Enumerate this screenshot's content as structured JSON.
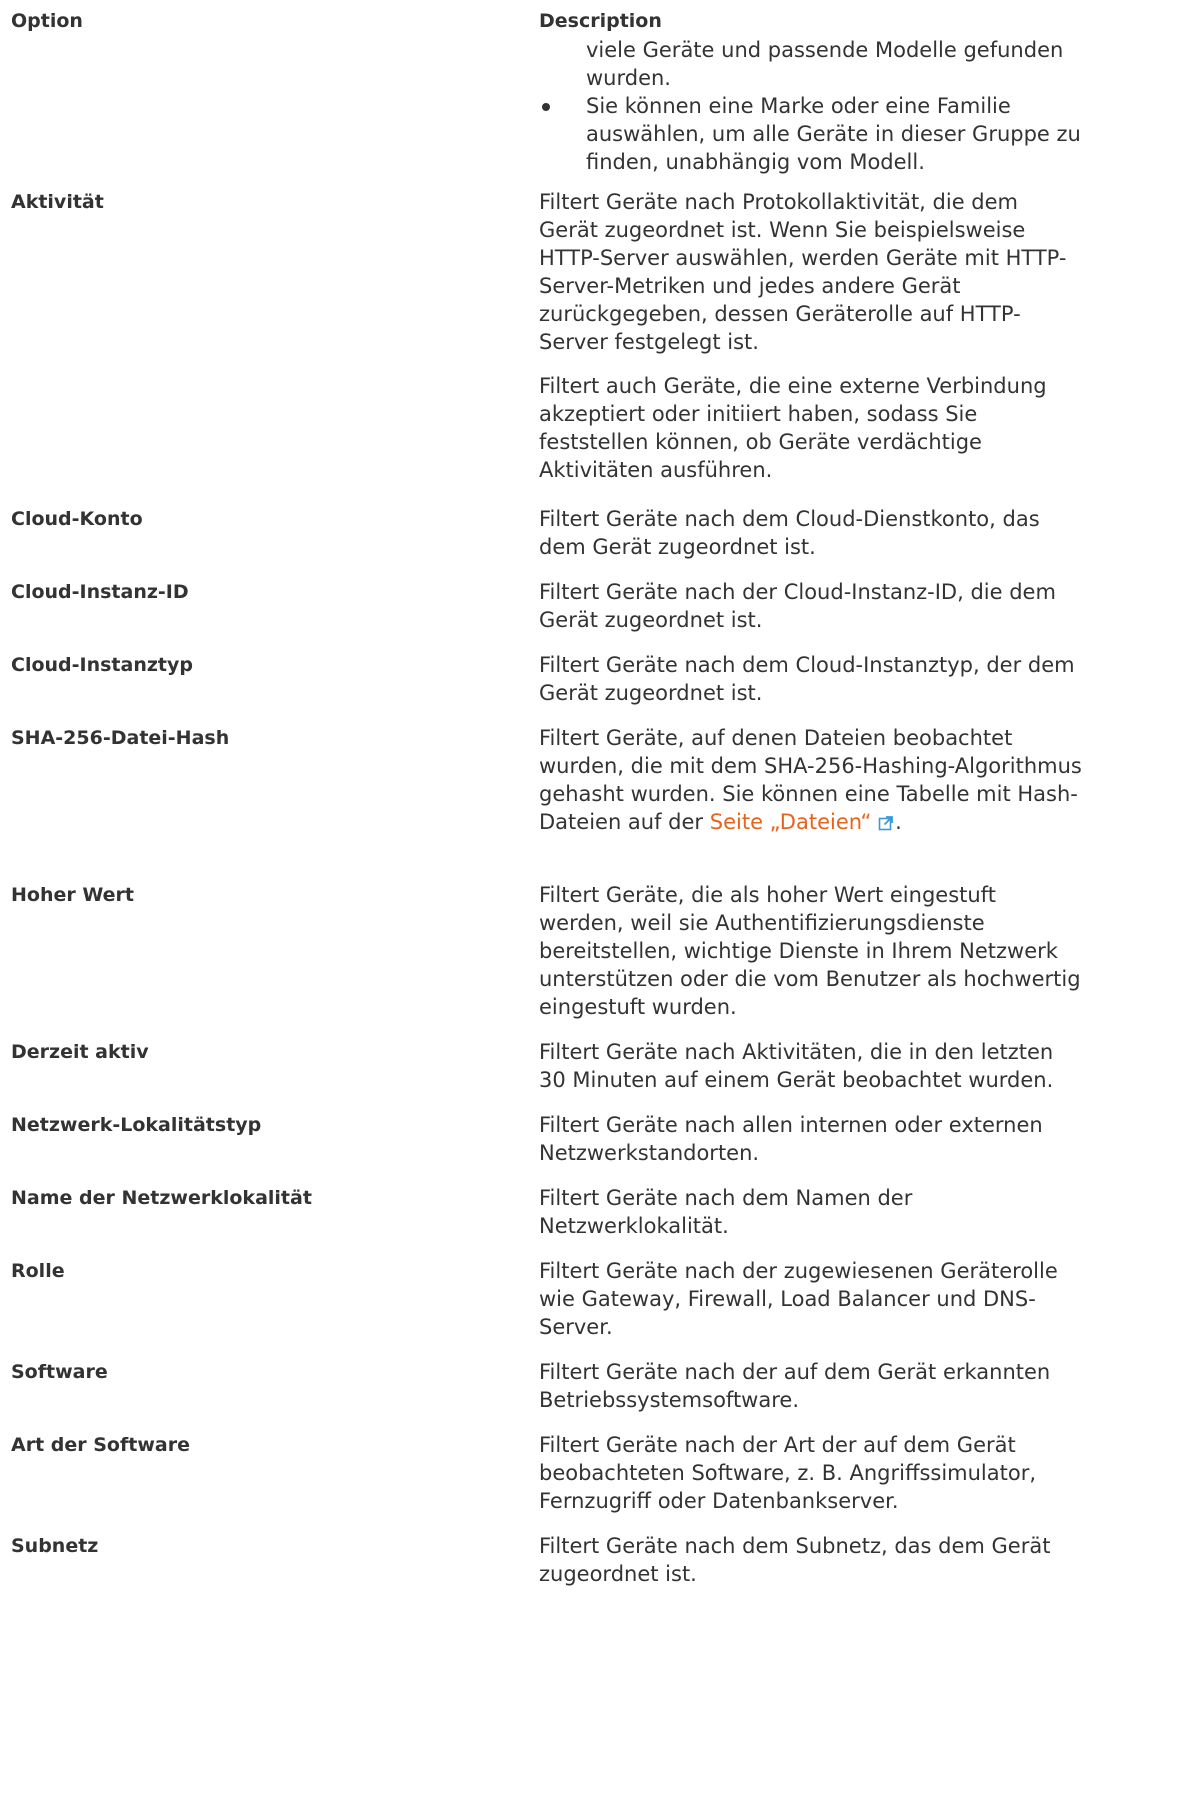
{
  "header": {
    "option": "Option",
    "description": "Description"
  },
  "intro_bullets": {
    "continued": "viele Geräte und passende Modelle gefunden wurden.",
    "item": "Sie können eine Marke oder eine Familie auswählen, um alle Geräte in dieser Gruppe zu finden, unabhängig vom Modell."
  },
  "rows": {
    "aktivitaet": {
      "option": "Aktivität",
      "p1": "Filtert Geräte nach Protokollaktivität, die dem Gerät zugeordnet ist. Wenn Sie beispielsweise HTTP-Server auswählen, werden Geräte mit HTTP-Server-Metriken und jedes andere Gerät zurückgegeben, dessen Geräterolle auf HTTP-Server festgelegt ist.",
      "p2": "Filtert auch Geräte, die eine externe Verbindung akzeptiert oder initiiert haben, sodass Sie feststellen können, ob Geräte verdächtige Aktivitäten ausführen."
    },
    "cloud_konto": {
      "option": "Cloud-Konto",
      "desc": "Filtert Geräte nach dem Cloud-Dienstkonto, das dem Gerät zugeordnet ist."
    },
    "cloud_instanz_id": {
      "option": "Cloud-Instanz-ID",
      "desc": "Filtert Geräte nach der Cloud-Instanz-ID, die dem Gerät zugeordnet ist."
    },
    "cloud_instanztyp": {
      "option": "Cloud-Instanztyp",
      "desc": "Filtert Geräte nach dem Cloud-Instanztyp, der dem Gerät zugeordnet ist."
    },
    "sha256": {
      "option": "SHA-256-Datei-Hash",
      "desc_before": "Filtert Geräte, auf denen Dateien beobachtet wurden, die mit dem SHA-256-Hashing-Algorithmus gehasht wurden. Sie können eine Tabelle mit Hash-Dateien auf der ",
      "link": "Seite „Dateien“",
      "desc_after": "."
    },
    "hoher_wert": {
      "option": "Hoher Wert",
      "desc": "Filtert Geräte, die als hoher Wert eingestuft werden, weil sie Authentifizierungsdienste bereitstellen, wichtige Dienste in Ihrem Netzwerk unterstützen oder die vom Benutzer als hochwertig eingestuft wurden."
    },
    "derzeit_aktiv": {
      "option": "Derzeit aktiv",
      "desc": "Filtert Geräte nach Aktivitäten, die in den letzten 30 Minuten auf einem Gerät beobachtet wurden."
    },
    "netzwerk_lokalitaetstyp": {
      "option": "Netzwerk-Lokalitätstyp",
      "desc": "Filtert Geräte nach allen internen oder externen Netzwerkstandorten."
    },
    "name_netzwerklokalitaet": {
      "option": "Name der Netzwerklokalität",
      "desc": "Filtert Geräte nach dem Namen der Netzwerklokalität."
    },
    "rolle": {
      "option": "Rolle",
      "desc": "Filtert Geräte nach der zugewiesenen Geräterolle wie Gateway, Firewall, Load Balancer und DNS-Server."
    },
    "software": {
      "option": "Software",
      "desc": "Filtert Geräte nach der auf dem Gerät erkannten Betriebssystemsoftware."
    },
    "art_der_software": {
      "option": "Art der Software",
      "desc": "Filtert Geräte nach der Art der auf dem Gerät beobachteten Software, z. B. Angriffssimulator, Fernzugriff oder Datenbankserver."
    },
    "subnetz": {
      "option": "Subnetz",
      "desc": "Filtert Geräte nach dem Subnetz, das dem Gerät zugeordnet ist."
    }
  },
  "colors": {
    "text": "#333333",
    "link": "#e8631a",
    "icon": "#3a9ad9"
  },
  "icons": {
    "external_link": "external-link-icon",
    "bullet": "bullet-icon"
  }
}
